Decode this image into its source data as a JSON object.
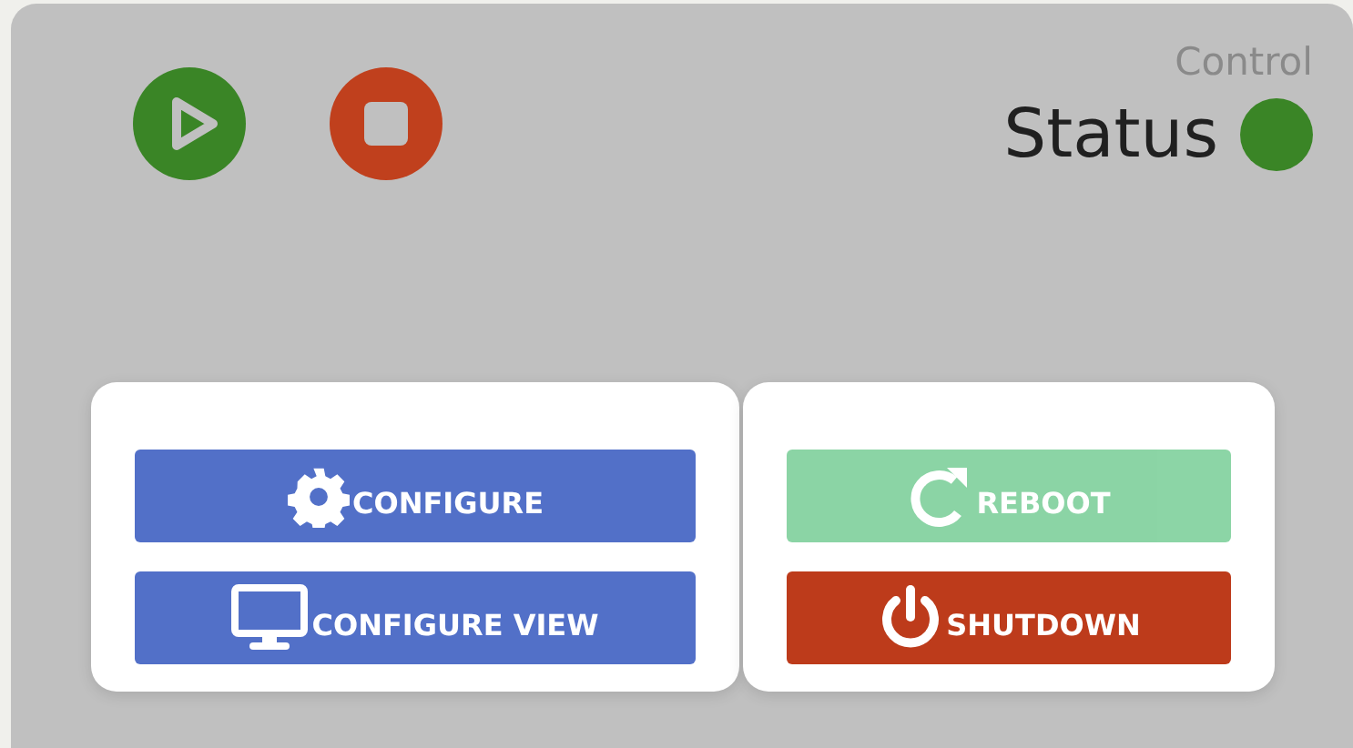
{
  "controls": [
    {
      "kind": "play"
    },
    {
      "kind": "stop"
    }
  ],
  "header": {
    "title": "Control",
    "status": {
      "label": "Status",
      "color": "#3a8526"
    }
  },
  "panels": [
    {
      "buttons": [
        {
          "kind": "configure",
          "label": "CONFIGURE",
          "disabled": false
        },
        {
          "kind": "view",
          "label": "CONFIGURE VIEW",
          "disabled": false
        }
      ]
    },
    {
      "buttons": [
        {
          "kind": "reboot",
          "label": "REBOOT",
          "disabled": true
        },
        {
          "kind": "shutdown",
          "label": "SHUTDOWN",
          "disabled": false
        }
      ]
    }
  ]
}
